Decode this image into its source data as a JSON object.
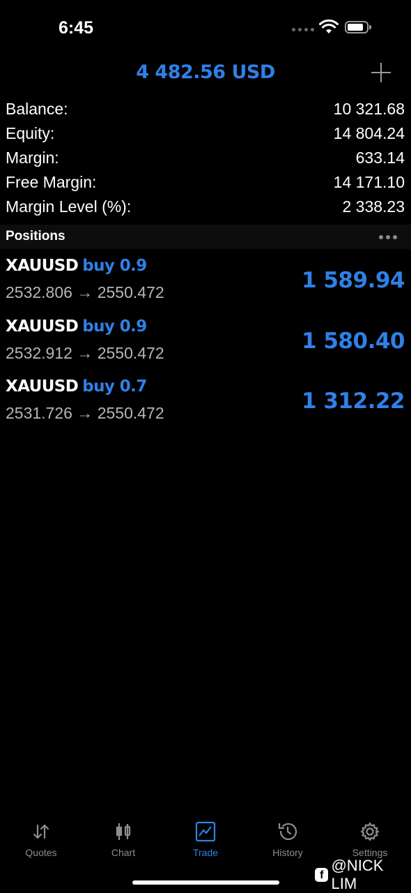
{
  "status_bar": {
    "time": "6:45"
  },
  "header": {
    "title": "4 482.56 USD"
  },
  "summary": [
    {
      "label": "Balance:",
      "value": "10 321.68"
    },
    {
      "label": "Equity:",
      "value": "14 804.24"
    },
    {
      "label": "Margin:",
      "value": "633.14"
    },
    {
      "label": "Free Margin:",
      "value": "14 171.10"
    },
    {
      "label": "Margin Level (%):",
      "value": "2 338.23"
    }
  ],
  "positions_section": {
    "title": "Positions"
  },
  "positions": [
    {
      "symbol": "XAUUSD",
      "side": "buy 0.9",
      "prices": "2532.806 → 2550.472",
      "profit": "1 589.94"
    },
    {
      "symbol": "XAUUSD",
      "side": "buy 0.9",
      "prices": "2532.912 → 2550.472",
      "profit": "1 580.40"
    },
    {
      "symbol": "XAUUSD",
      "side": "buy 0.7",
      "prices": "2531.726 → 2550.472",
      "profit": "1 312.22"
    }
  ],
  "tabbar": [
    {
      "label": "Quotes",
      "icon": "quotes-icon",
      "active": false
    },
    {
      "label": "Chart",
      "icon": "chart-icon",
      "active": false
    },
    {
      "label": "Trade",
      "icon": "trade-icon",
      "active": true
    },
    {
      "label": "History",
      "icon": "history-icon",
      "active": false
    },
    {
      "label": "Settings",
      "icon": "gear-icon",
      "active": false
    }
  ],
  "watermark": {
    "logo": "f",
    "text": "@NICK LIM"
  },
  "colors": {
    "accent": "#2f80e8",
    "background": "#000000",
    "muted": "#8e8e8e"
  }
}
